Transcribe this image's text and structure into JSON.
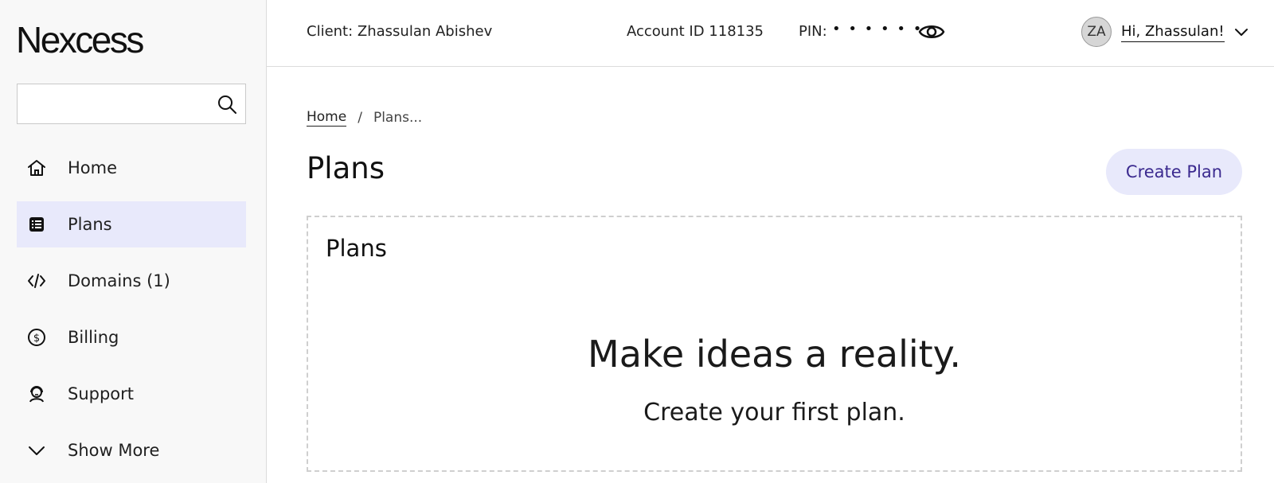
{
  "sidebar": {
    "logo": "Nexcess",
    "search": {
      "value": "",
      "placeholder": ""
    },
    "items": [
      {
        "label": "Home",
        "icon": "home-icon",
        "active": false
      },
      {
        "label": "Plans",
        "icon": "list-icon",
        "active": true
      },
      {
        "label": "Domains (1)",
        "icon": "code-icon",
        "active": false
      },
      {
        "label": "Billing",
        "icon": "dollar-icon",
        "active": false
      },
      {
        "label": "Support",
        "icon": "support-icon",
        "active": false
      },
      {
        "label": "Show More",
        "icon": "chevron-down-icon",
        "active": false
      }
    ]
  },
  "header": {
    "client": "Client: Zhassulan Abishev",
    "account": "Account ID 118135",
    "pin_label": "PIN:",
    "pin_masked": "• • • • • •",
    "avatar_initials": "ZA",
    "greeting": "Hi, Zhassulan!"
  },
  "breadcrumb": {
    "home": "Home",
    "separator": "/",
    "current": "Plans..."
  },
  "main": {
    "title": "Plans",
    "create_button": "Create Plan",
    "panel_title": "Plans",
    "empty_title": "Make ideas a reality.",
    "empty_subtitle": "Create your first plan."
  },
  "colors": {
    "accent_bg": "#e8e9fb",
    "accent_text": "#3b2a8f",
    "sidebar_bg": "#f8f8f8"
  }
}
